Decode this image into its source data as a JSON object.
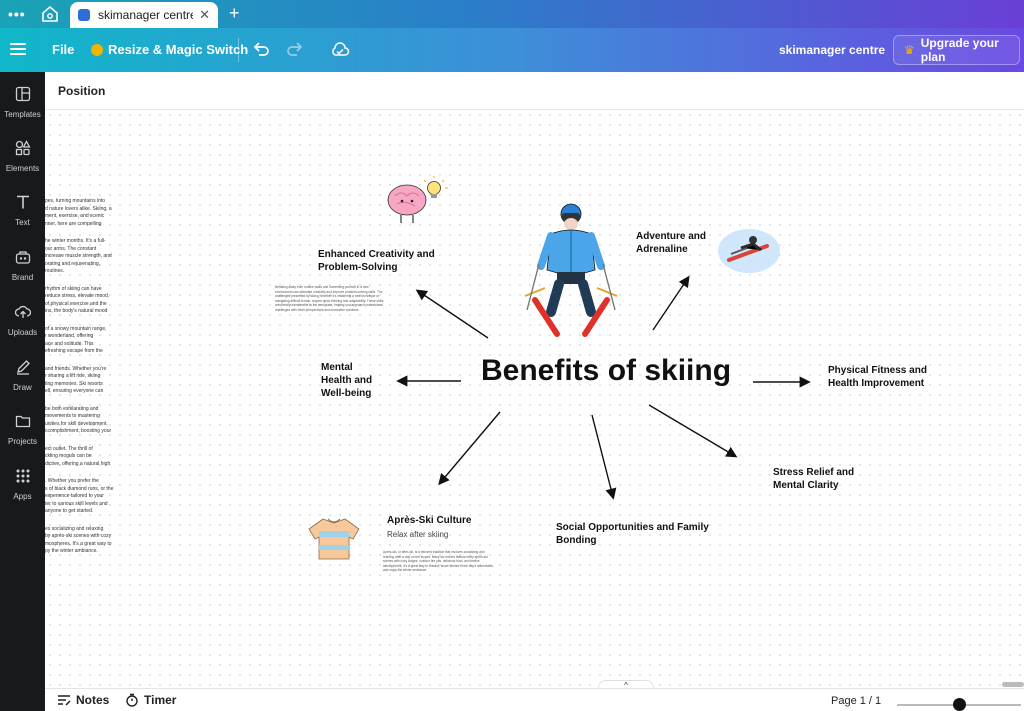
{
  "browser": {
    "tab_title": "skimanager centre ...",
    "tab_close": "✕",
    "new_tab": "+",
    "menu_dots": "•••"
  },
  "toolbar": {
    "file_label": "File",
    "resize_label": "Resize & Magic Switch",
    "doc_name": "skimanager centre",
    "upgrade_label": "Upgrade your plan"
  },
  "sidebar": {
    "items": [
      {
        "label": "Templates",
        "icon": "templates-icon"
      },
      {
        "label": "Elements",
        "icon": "elements-icon"
      },
      {
        "label": "Text",
        "icon": "text-icon"
      },
      {
        "label": "Brand",
        "icon": "brand-icon"
      },
      {
        "label": "Uploads",
        "icon": "uploads-icon"
      },
      {
        "label": "Draw",
        "icon": "draw-icon"
      },
      {
        "label": "Projects",
        "icon": "projects-icon"
      },
      {
        "label": "Apps",
        "icon": "apps-icon"
      }
    ]
  },
  "position_bar": {
    "label": "Position"
  },
  "canvas": {
    "overflow_text": [
      "pes, turning mountains into\nd nature lovers alike. Skiing, a\nment, exercise, and scenic\nnner, here are compelling",
      "he winter months. It's a full-\nour arms. The constant\nincrease muscle strength, and\norating and rejuvenating,\nroutines.",
      "rhythm of skiing can have\nreduce stress, elevate mood,\nof physical exercise and the\nins, the body's natural mood",
      "of a snowy mountain range,\nr wonderland, offering\nace and solitude. This\nefreshing escape from the",
      "and friends. Whether you're\nr sharing a lift ride, skiing\nting memories. Ski resorts\nell, ensuring everyone can",
      "be both exhilarating and\nmovements to mastering\nunities for skill development,\nccomplishment, boosting your",
      "ect outlet. The thrill of\nckling moguls can be\ndictive, offering a natural high",
      ". Whether you prefer the\ns of black diamond runs, or the\nexperience tailored to your\nter to various skill levels and\nanyone to get started.",
      "es socializing and relaxing\nby après-ski scenes with cozy\nmospheres. It's a great way to\npy the winter ambiance."
    ],
    "title": "Benefits of skiing",
    "nodes": {
      "creativity": "Enhanced Creativity and\nProblem-Solving",
      "adventure": "Adventure and\nAdrenaline",
      "mental": "Mental\nHealth and\nWell-being",
      "fitness": "Physical Fitness and\nHealth Improvement",
      "stress": "Stress Relief and\nMental Clarity",
      "social": "Social Opportunities and Family\nBonding",
      "apres": "Après-Ski Culture"
    },
    "apres_sub": "Relax after skiing",
    "creativity_tiny": "Breaking away from routine tasks and immersing yourself in a new environment can stimulate creativity and improve problem-solving skills. The challenges presented by skiing, whether it's mastering a new technique or navigating difficult terrain, require quick thinking and adaptability. These skills are directly transferable to the workplace, helping you approach professional challenges with fresh perspectives and innovative solutions.",
    "apres_tiny": "Après-ski, or after-ski, is a beloved tradition that involves socializing and relaxing after a day on the slopes. Many ski resorts feature lively après-ski scenes with cozy lodges, outdoor fire pits, delicious food, and festive atmospheres. It's a great way to unwind, share stories of the day's adventures, and enjoy the winter ambiance."
  },
  "bottom": {
    "notes_label": "Notes",
    "timer_label": "Timer",
    "page_label": "Page 1 / 1",
    "collapse_glyph": "^"
  },
  "colors": {
    "toolbar_start": "#10b7c9",
    "toolbar_end": "#6a49e2",
    "sidebar_bg": "#18191b",
    "crown": "#f5b301"
  }
}
